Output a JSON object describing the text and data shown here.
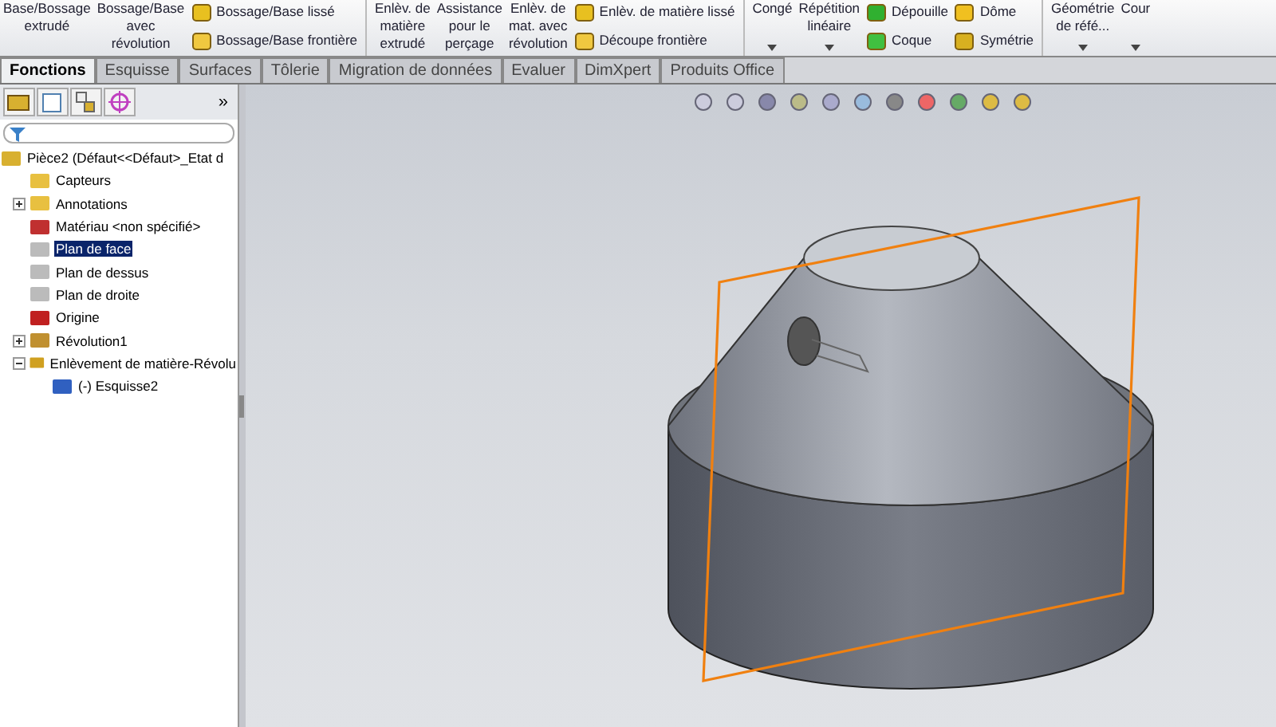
{
  "ribbon": {
    "items": [
      {
        "kind": "big",
        "label": "Base/Bossage\nextrudé"
      },
      {
        "kind": "big",
        "label": "Bossage/Base\navec\nrévolution"
      },
      {
        "kind": "small",
        "entries": [
          {
            "label": "Bossage/Base lissé"
          },
          {
            "label": "Bossage/Base frontière"
          }
        ]
      },
      {
        "kind": "separator"
      },
      {
        "kind": "big",
        "label": "Enlèv. de\nmatière\nextrudé"
      },
      {
        "kind": "big",
        "label": "Assistance\npour le\nperçage"
      },
      {
        "kind": "big",
        "label": "Enlèv. de\nmat. avec\nrévolution"
      },
      {
        "kind": "small",
        "entries": [
          {
            "label": "Enlèv. de matière lissé"
          },
          {
            "label": "Découpe frontière"
          }
        ]
      },
      {
        "kind": "separator"
      },
      {
        "kind": "dropdown",
        "label": "Congé"
      },
      {
        "kind": "dropdown",
        "label": "Répétition\nlinéaire"
      },
      {
        "kind": "small",
        "entries": [
          {
            "label": "Dépouille"
          },
          {
            "label": "Coque"
          }
        ]
      },
      {
        "kind": "small",
        "entries": [
          {
            "label": "Dôme"
          },
          {
            "label": "Symétrie"
          }
        ]
      },
      {
        "kind": "separator"
      },
      {
        "kind": "dropdown",
        "label": "Géométrie\nde réfé..."
      },
      {
        "kind": "dropdown",
        "label": "Cour"
      }
    ]
  },
  "tabs": [
    {
      "label": "Fonctions",
      "selected": true
    },
    {
      "label": "Esquisse",
      "selected": false
    },
    {
      "label": "Surfaces",
      "selected": false
    },
    {
      "label": "Tôlerie",
      "selected": false
    },
    {
      "label": "Migration de données",
      "selected": false
    },
    {
      "label": "Evaluer",
      "selected": false
    },
    {
      "label": "DimXpert",
      "selected": false
    },
    {
      "label": "Produits Office",
      "selected": false
    }
  ],
  "panel": {
    "more": "»",
    "tree": [
      {
        "label": "Pièce2  (Défaut<<Défaut>_Etat d",
        "selected": false,
        "children": [
          {
            "label": "Capteurs",
            "selected": false
          },
          {
            "label": "Annotations",
            "expanded": false,
            "selected": false
          },
          {
            "label": "Matériau <non spécifié>",
            "selected": false
          },
          {
            "label": "Plan de face",
            "selected": true
          },
          {
            "label": "Plan de dessus",
            "selected": false
          },
          {
            "label": "Plan de droite",
            "selected": false
          },
          {
            "label": "Origine",
            "selected": false
          },
          {
            "label": "Révolution1",
            "expanded": false,
            "selected": false
          },
          {
            "label": "Enlèvement de matière-Révolu",
            "expanded": true,
            "selected": false,
            "children": [
              {
                "label": "(-) Esquisse2",
                "selected": false
              }
            ]
          }
        ]
      }
    ]
  }
}
